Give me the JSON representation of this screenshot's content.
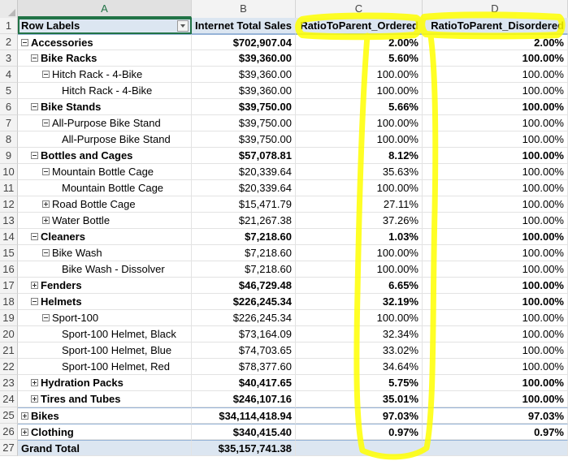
{
  "columns": [
    "A",
    "B",
    "C",
    "D"
  ],
  "header": {
    "row_num": "1",
    "row_labels": "Row Labels",
    "sales": "Internet Total Sales",
    "ordered": "RatioToParent_Ordered",
    "disordered": "RatioToParent_Disordered"
  },
  "rows": [
    {
      "num": "2",
      "label": "Accessories",
      "level": 0,
      "toggle": "minus",
      "bold": true,
      "sales": "$702,907.04",
      "ordered": "2.00%",
      "disordered": "2.00%"
    },
    {
      "num": "3",
      "label": "Bike Racks",
      "level": 1,
      "toggle": "minus",
      "bold": true,
      "sales": "$39,360.00",
      "ordered": "5.60%",
      "disordered": "100.00%"
    },
    {
      "num": "4",
      "label": "Hitch Rack - 4-Bike",
      "level": 2,
      "toggle": "minus",
      "bold": false,
      "sales": "$39,360.00",
      "ordered": "100.00%",
      "disordered": "100.00%"
    },
    {
      "num": "5",
      "label": "Hitch Rack - 4-Bike",
      "level": 3,
      "toggle": "",
      "bold": false,
      "sales": "$39,360.00",
      "ordered": "100.00%",
      "disordered": "100.00%"
    },
    {
      "num": "6",
      "label": "Bike Stands",
      "level": 1,
      "toggle": "minus",
      "bold": true,
      "sales": "$39,750.00",
      "ordered": "5.66%",
      "disordered": "100.00%"
    },
    {
      "num": "7",
      "label": "All-Purpose Bike Stand",
      "level": 2,
      "toggle": "minus",
      "bold": false,
      "sales": "$39,750.00",
      "ordered": "100.00%",
      "disordered": "100.00%"
    },
    {
      "num": "8",
      "label": "All-Purpose Bike Stand",
      "level": 3,
      "toggle": "",
      "bold": false,
      "sales": "$39,750.00",
      "ordered": "100.00%",
      "disordered": "100.00%"
    },
    {
      "num": "9",
      "label": "Bottles and Cages",
      "level": 1,
      "toggle": "minus",
      "bold": true,
      "sales": "$57,078.81",
      "ordered": "8.12%",
      "disordered": "100.00%"
    },
    {
      "num": "10",
      "label": "Mountain Bottle Cage",
      "level": 2,
      "toggle": "minus",
      "bold": false,
      "sales": "$20,339.64",
      "ordered": "35.63%",
      "disordered": "100.00%"
    },
    {
      "num": "11",
      "label": "Mountain Bottle Cage",
      "level": 3,
      "toggle": "",
      "bold": false,
      "sales": "$20,339.64",
      "ordered": "100.00%",
      "disordered": "100.00%"
    },
    {
      "num": "12",
      "label": "Road Bottle Cage",
      "level": 2,
      "toggle": "plus",
      "bold": false,
      "sales": "$15,471.79",
      "ordered": "27.11%",
      "disordered": "100.00%"
    },
    {
      "num": "13",
      "label": "Water Bottle",
      "level": 2,
      "toggle": "plus",
      "bold": false,
      "sales": "$21,267.38",
      "ordered": "37.26%",
      "disordered": "100.00%"
    },
    {
      "num": "14",
      "label": "Cleaners",
      "level": 1,
      "toggle": "minus",
      "bold": true,
      "sales": "$7,218.60",
      "ordered": "1.03%",
      "disordered": "100.00%"
    },
    {
      "num": "15",
      "label": "Bike Wash",
      "level": 2,
      "toggle": "minus",
      "bold": false,
      "sales": "$7,218.60",
      "ordered": "100.00%",
      "disordered": "100.00%"
    },
    {
      "num": "16",
      "label": "Bike Wash - Dissolver",
      "level": 3,
      "toggle": "",
      "bold": false,
      "sales": "$7,218.60",
      "ordered": "100.00%",
      "disordered": "100.00%"
    },
    {
      "num": "17",
      "label": "Fenders",
      "level": 1,
      "toggle": "plus",
      "bold": true,
      "sales": "$46,729.48",
      "ordered": "6.65%",
      "disordered": "100.00%"
    },
    {
      "num": "18",
      "label": "Helmets",
      "level": 1,
      "toggle": "minus",
      "bold": true,
      "sales": "$226,245.34",
      "ordered": "32.19%",
      "disordered": "100.00%"
    },
    {
      "num": "19",
      "label": "Sport-100",
      "level": 2,
      "toggle": "minus",
      "bold": false,
      "sales": "$226,245.34",
      "ordered": "100.00%",
      "disordered": "100.00%"
    },
    {
      "num": "20",
      "label": "Sport-100 Helmet, Black",
      "level": 3,
      "toggle": "",
      "bold": false,
      "sales": "$73,164.09",
      "ordered": "32.34%",
      "disordered": "100.00%"
    },
    {
      "num": "21",
      "label": "Sport-100 Helmet, Blue",
      "level": 3,
      "toggle": "",
      "bold": false,
      "sales": "$74,703.65",
      "ordered": "33.02%",
      "disordered": "100.00%"
    },
    {
      "num": "22",
      "label": "Sport-100 Helmet, Red",
      "level": 3,
      "toggle": "",
      "bold": false,
      "sales": "$78,377.60",
      "ordered": "34.64%",
      "disordered": "100.00%"
    },
    {
      "num": "23",
      "label": "Hydration Packs",
      "level": 1,
      "toggle": "plus",
      "bold": true,
      "sales": "$40,417.65",
      "ordered": "5.75%",
      "disordered": "100.00%"
    },
    {
      "num": "24",
      "label": "Tires and Tubes",
      "level": 1,
      "toggle": "plus",
      "bold": true,
      "sales": "$246,107.16",
      "ordered": "35.01%",
      "disordered": "100.00%"
    },
    {
      "num": "25",
      "label": "Bikes",
      "level": 0,
      "toggle": "plus",
      "bold": true,
      "sales": "$34,114,418.94",
      "ordered": "97.03%",
      "disordered": "97.03%"
    },
    {
      "num": "26",
      "label": "Clothing",
      "level": 0,
      "toggle": "plus",
      "bold": true,
      "sales": "$340,415.40",
      "ordered": "0.97%",
      "disordered": "0.97%"
    }
  ],
  "grand_total": {
    "num": "27",
    "label": "Grand Total",
    "sales": "$35,157,741.38",
    "ordered": "",
    "disordered": ""
  },
  "highlight_color": "#ffff00",
  "selection_color": "#217346"
}
